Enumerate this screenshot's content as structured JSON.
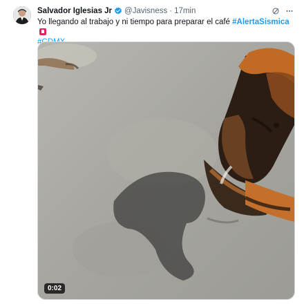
{
  "tweet": {
    "author_name": "Salvador Iglesias Jr",
    "handle": "@Javisness",
    "separator": "·",
    "time": "17min",
    "text_before": "Yo llegando al trabajo y ni tiempo para preparar el café ",
    "hashtag_1": "#AlertaSismica",
    "hashtag_2": "#CDMX",
    "icons": {
      "avatar": "user-avatar",
      "verified": "verified-badge-icon",
      "grok": "grok-icon",
      "more": "more-options-icon",
      "alert_emoji": "alert-emoji-icon"
    },
    "colors": {
      "link": "#1d9bf0",
      "verified": "#1d9bf0",
      "muted": "#536471"
    }
  },
  "media": {
    "type": "video",
    "duration": "0:02"
  }
}
